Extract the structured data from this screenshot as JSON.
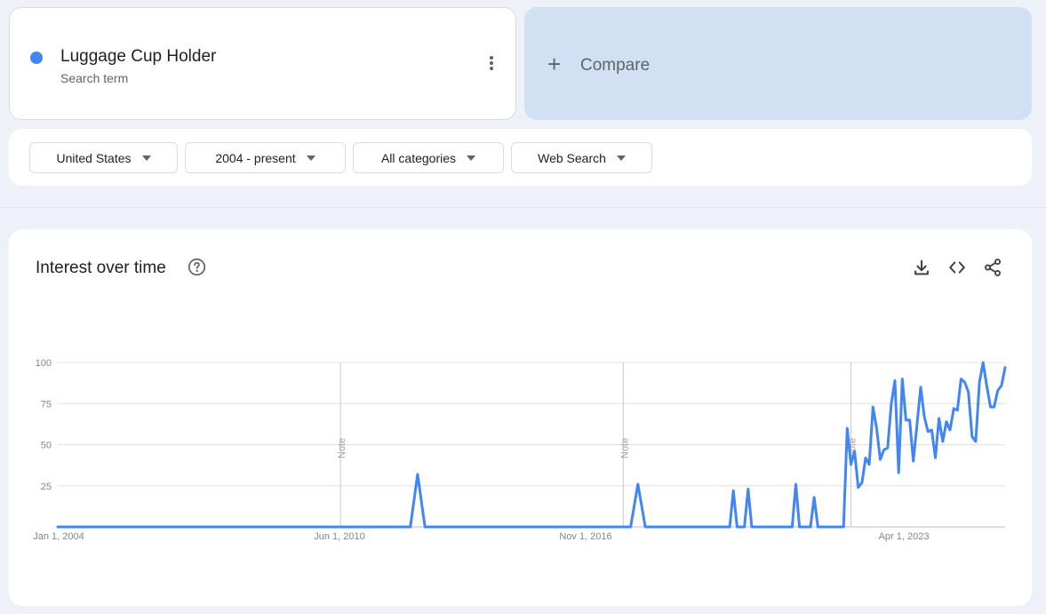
{
  "search_term": {
    "name": "Luggage Cup Holder",
    "subtitle": "Search term",
    "color": "#4285f4"
  },
  "compare": {
    "label": "Compare"
  },
  "filters": {
    "region": "United States",
    "time_range": "2004 - present",
    "category": "All categories",
    "search_type": "Web Search"
  },
  "chart_card": {
    "title": "Interest over time",
    "icons": [
      "help-icon",
      "download-icon",
      "embed-icon",
      "share-icon"
    ]
  },
  "chart_data": {
    "type": "line",
    "title": "Interest over time",
    "xlabel": "",
    "ylabel": "",
    "ylim": [
      0,
      100
    ],
    "yticks": [
      25,
      50,
      75,
      100
    ],
    "x_tick_labels": [
      "Jan 1, 2004",
      "Jun 1, 2010",
      "Nov 1, 2016",
      "Apr 1, 2023"
    ],
    "x_range": [
      "2004-01",
      "2025-07"
    ],
    "notes": [
      {
        "x": "2010-06",
        "label": "Note"
      },
      {
        "x": "2016-11",
        "label": "Note"
      },
      {
        "x": "2022-01",
        "label": "Note"
      }
    ],
    "grid": true,
    "series": [
      {
        "name": "Luggage Cup Holder",
        "color": "#4285f4",
        "points": [
          [
            "2004-01",
            0
          ],
          [
            "2012-01",
            0
          ],
          [
            "2012-03",
            32
          ],
          [
            "2012-05",
            0
          ],
          [
            "2017-01",
            0
          ],
          [
            "2017-03",
            26
          ],
          [
            "2017-05",
            0
          ],
          [
            "2019-04",
            0
          ],
          [
            "2019-05",
            22
          ],
          [
            "2019-06",
            0
          ],
          [
            "2019-08",
            0
          ],
          [
            "2019-09",
            23
          ],
          [
            "2019-10",
            0
          ],
          [
            "2020-09",
            0
          ],
          [
            "2020-10",
            26
          ],
          [
            "2020-11",
            0
          ],
          [
            "2021-02",
            0
          ],
          [
            "2021-03",
            18
          ],
          [
            "2021-04",
            0
          ],
          [
            "2021-11",
            0
          ],
          [
            "2021-12",
            60
          ],
          [
            "2022-01",
            38
          ],
          [
            "2022-02",
            46
          ],
          [
            "2022-03",
            24
          ],
          [
            "2022-04",
            27
          ],
          [
            "2022-05",
            42
          ],
          [
            "2022-06",
            38
          ],
          [
            "2022-07",
            73
          ],
          [
            "2022-08",
            60
          ],
          [
            "2022-09",
            41
          ],
          [
            "2022-10",
            47
          ],
          [
            "2022-11",
            48
          ],
          [
            "2022-12",
            75
          ],
          [
            "2023-01",
            89
          ],
          [
            "2023-02",
            33
          ],
          [
            "2023-03",
            90
          ],
          [
            "2023-04",
            65
          ],
          [
            "2023-05",
            65
          ],
          [
            "2023-06",
            40
          ],
          [
            "2023-07",
            62
          ],
          [
            "2023-08",
            85
          ],
          [
            "2023-09",
            67
          ],
          [
            "2023-10",
            58
          ],
          [
            "2023-11",
            59
          ],
          [
            "2023-12",
            42
          ],
          [
            "2024-01",
            66
          ],
          [
            "2024-02",
            52
          ],
          [
            "2024-03",
            64
          ],
          [
            "2024-04",
            59
          ],
          [
            "2024-05",
            72
          ],
          [
            "2024-06",
            71
          ],
          [
            "2024-07",
            90
          ],
          [
            "2024-08",
            88
          ],
          [
            "2024-09",
            82
          ],
          [
            "2024-10",
            55
          ],
          [
            "2024-11",
            52
          ],
          [
            "2024-12",
            88
          ],
          [
            "2025-01",
            100
          ],
          [
            "2025-02",
            86
          ],
          [
            "2025-03",
            73
          ],
          [
            "2025-04",
            73
          ],
          [
            "2025-05",
            83
          ],
          [
            "2025-06",
            86
          ],
          [
            "2025-07",
            97
          ]
        ]
      }
    ]
  }
}
